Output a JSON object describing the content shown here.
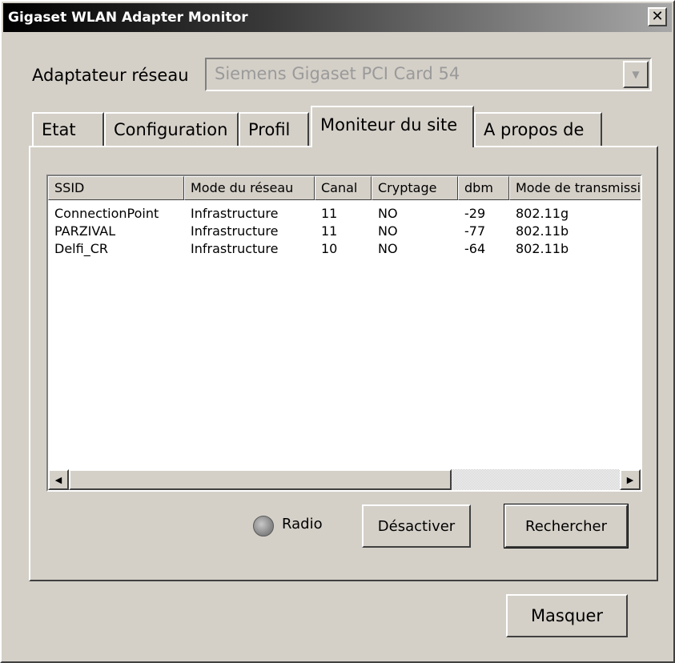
{
  "window": {
    "title": "Gigaset WLAN Adapter Monitor",
    "close_glyph": "✕"
  },
  "adapter": {
    "label": "Adaptateur réseau",
    "selected": "Siemens Gigaset PCI Card 54"
  },
  "tabs": [
    {
      "label": "Etat"
    },
    {
      "label": "Configuration"
    },
    {
      "label": "Profil"
    },
    {
      "label": "Moniteur du site"
    },
    {
      "label": "A propos de"
    }
  ],
  "active_tab": "Moniteur du site",
  "site_list": {
    "columns": [
      "SSID",
      "Mode du réseau",
      "Canal",
      "Cryptage",
      "dbm",
      "Mode de transmission"
    ],
    "rows": [
      [
        "ConnectionPoint",
        "Infrastructure",
        "11",
        "NO",
        "-29",
        "802.11g"
      ],
      [
        "PARZIVAL",
        "Infrastructure",
        "11",
        "NO",
        "-77",
        "802.11b"
      ],
      [
        "Delfi_CR",
        "Infrastructure",
        "10",
        "NO",
        "-64",
        "802.11b"
      ]
    ]
  },
  "radio": {
    "label": "Radio",
    "status_color": "#8a8a8a"
  },
  "buttons": {
    "deactivate": "Désactiver",
    "search": "Rechercher",
    "hide": "Masquer"
  },
  "icons": {
    "close": "close-icon",
    "dropdown": "chevron-down-icon",
    "scroll_left": "arrow-left-icon",
    "scroll_right": "arrow-right-icon",
    "radio_led": "led-indicator-icon"
  },
  "colors": {
    "window_bg": "#d4d0c8",
    "title_start": "#000000",
    "title_end": "#a8a8a8",
    "disabled_text": "#9a9a9a"
  }
}
